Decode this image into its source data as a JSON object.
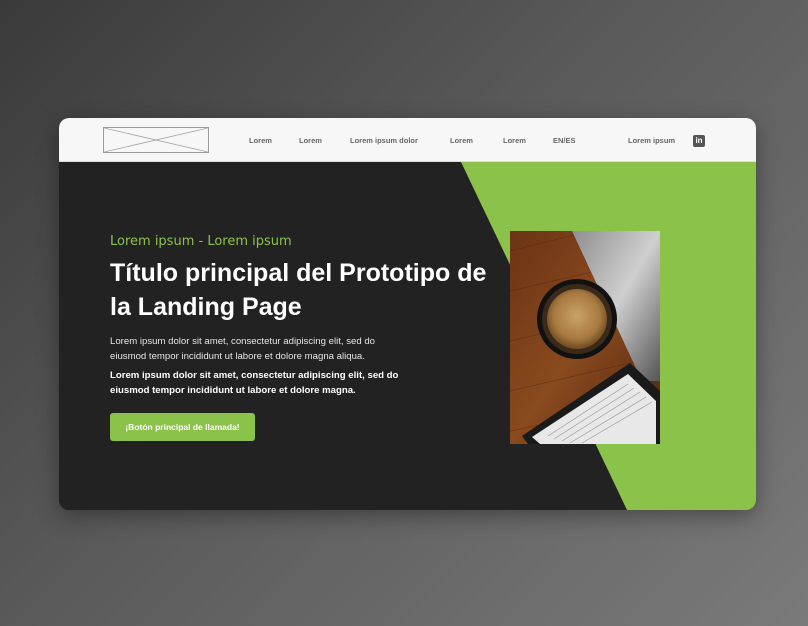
{
  "nav": {
    "links": [
      "Lorem",
      "Lorem",
      "Lorem ipsum dolor",
      "Lorem",
      "Lorem",
      "EN/ES"
    ],
    "right_link": "Lorem ipsum",
    "linkedin_icon": "linkedin-icon",
    "logo": "logo-placeholder"
  },
  "hero": {
    "eyebrow": "Lorem ipsum - Lorem ipsum",
    "title": "Título principal del Prototipo de la Landing Page",
    "paragraph": "Lorem ipsum dolor sit amet, consectetur adipiscing elit, sed do eiusmod tempor incididunt ut labore et dolore magna aliqua.",
    "paragraph_bold": "Lorem ipsum dolor sit amet, consectetur adipiscing elit, sed do eiusmod tempor incididunt ut labore et dolore magna.",
    "cta_label": "¡Botón principal de llamada!",
    "image": "coffee-cup-and-ereader-photo"
  },
  "colors": {
    "accent": "#8bc34a",
    "dark_bg": "#222222",
    "nav_bg": "#f7f7f7"
  }
}
